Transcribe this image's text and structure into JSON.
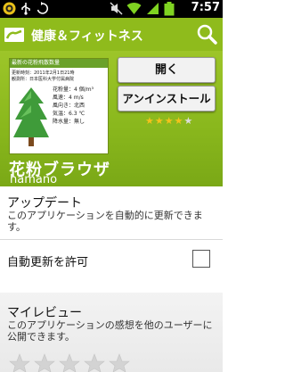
{
  "status_bar": {
    "time": "7:57",
    "icons": [
      "app-notification-icon",
      "usb-icon",
      "sync-icon",
      "mute-icon",
      "wifi-icon",
      "signal-icon",
      "battery-icon"
    ]
  },
  "header": {
    "category_title": "健康＆フィットネス",
    "accent_color": "#8fbb1c"
  },
  "app": {
    "name": "花粉ブラウザ",
    "developer": "hamano",
    "open_label": "開く",
    "uninstall_label": "アンインストール",
    "rating": 4,
    "rating_max": 5,
    "screenshot": {
      "header": "最新の花粉飛散数量",
      "date": "更新時刻：2011年2月1日21時",
      "place": "観測所：日本医科大学付属病院",
      "stats": [
        "花粉量：4 個/m³",
        "風速：4 m/s",
        "風向き：北西",
        "気温：6.3 ℃",
        "降水量：無し"
      ]
    }
  },
  "update": {
    "title": "アップデート",
    "description": "このアプリケーションを自動的に更新できます。",
    "auto_update_label": "自動更新を許可",
    "auto_update_checked": false
  },
  "my_review": {
    "title": "マイレビュー",
    "description": "このアプリケーションの感想を他のユーザーに公開できます。",
    "stars": 5
  }
}
